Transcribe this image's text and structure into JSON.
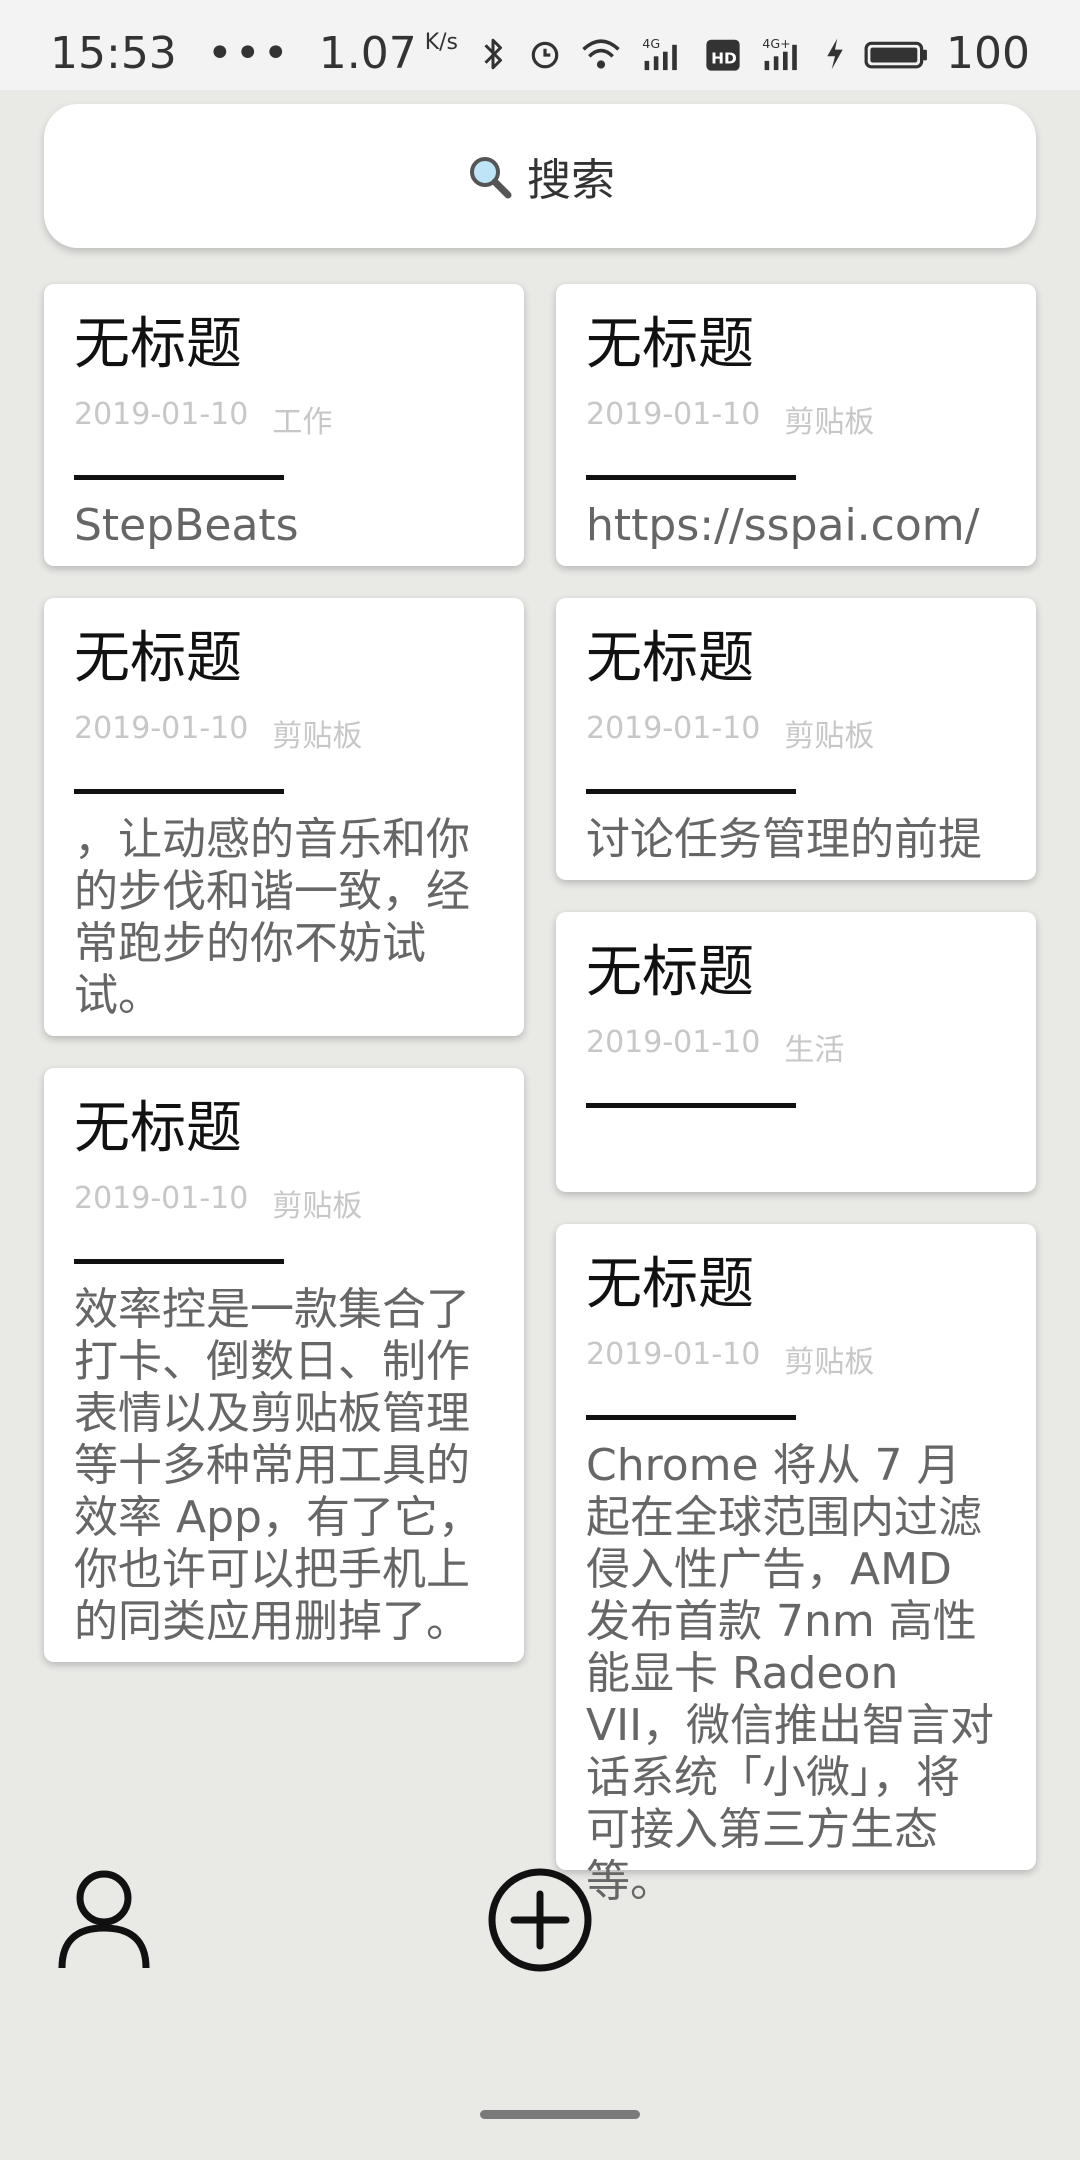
{
  "status_bar": {
    "time": "15:53",
    "dots": "•••",
    "net_speed": "1.07",
    "net_speed_unit": "K/s",
    "battery": "100",
    "icons": [
      "bluetooth-icon",
      "alarm-icon",
      "wifi-icon",
      "signal-4g-icon",
      "hd-icon",
      "signal-4g-plus-icon",
      "charging-icon",
      "battery-icon"
    ]
  },
  "search": {
    "icon": "search-icon",
    "label": "搜索"
  },
  "cards": [
    {
      "title": "无标题",
      "date": "2019-01-10",
      "category": "工作",
      "body": "StepBeats"
    },
    {
      "title": "无标题",
      "date": "2019-01-10",
      "category": "剪贴板",
      "body": "https://sspai.com/"
    },
    {
      "title": "无标题",
      "date": "2019-01-10",
      "category": "剪贴板",
      "body": "，让动感的音乐和你的步伐和谐一致，经常跑步的你不妨试试。"
    },
    {
      "title": "无标题",
      "date": "2019-01-10",
      "category": "剪贴板",
      "body": "讨论任务管理的前提"
    },
    {
      "title": "无标题",
      "date": "2019-01-10",
      "category": "生活",
      "body": ""
    },
    {
      "title": "无标题",
      "date": "2019-01-10",
      "category": "剪贴板",
      "body": "效率控是一款集合了打卡、倒数日、制作表情以及剪贴板管理等十多种常用工具的效率 App，有了它，你也许可以把手机上的同类应用删掉了。"
    },
    {
      "title": "无标题",
      "date": "2019-01-10",
      "category": "剪贴板",
      "body": "Chrome 将从 7 月起在全球范围内过滤侵入性广告，AMD 发布首款 7nm 高性能显卡 Radeon VII，微信推出智言对话系统「小微」，将可接入第三方生态等。"
    }
  ],
  "bottom_nav": {
    "profile_icon": "person-icon",
    "add_icon": "add-circle-icon"
  }
}
